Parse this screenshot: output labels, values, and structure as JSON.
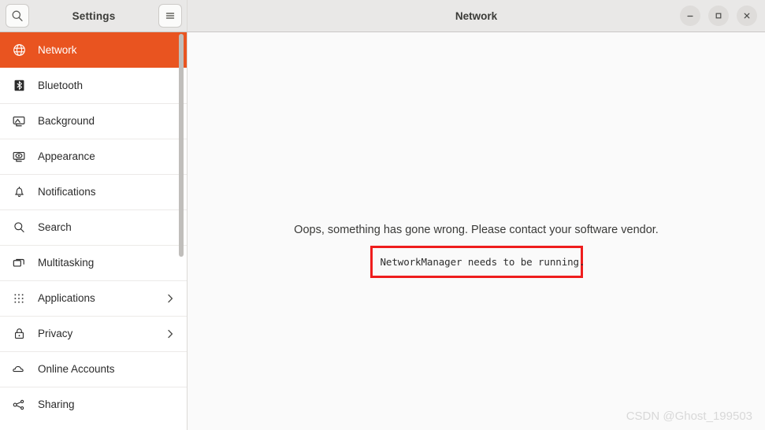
{
  "window": {
    "app_title": "Settings",
    "page_title": "Network",
    "controls": {
      "minimize_label": "Minimize",
      "maximize_label": "Maximize",
      "close_label": "Close"
    }
  },
  "header": {
    "search_icon": "search-icon",
    "menu_icon": "hamburger-menu-icon"
  },
  "sidebar": {
    "items": [
      {
        "label": "Network",
        "icon": "globe-icon",
        "selected": true,
        "chevron": false
      },
      {
        "label": "Bluetooth",
        "icon": "bluetooth-icon",
        "selected": false,
        "chevron": false
      },
      {
        "label": "Background",
        "icon": "monitor-icon",
        "selected": false,
        "chevron": false
      },
      {
        "label": "Appearance",
        "icon": "appearance-icon",
        "selected": false,
        "chevron": false
      },
      {
        "label": "Notifications",
        "icon": "bell-icon",
        "selected": false,
        "chevron": false
      },
      {
        "label": "Search",
        "icon": "search-icon",
        "selected": false,
        "chevron": false
      },
      {
        "label": "Multitasking",
        "icon": "windows-icon",
        "selected": false,
        "chevron": false
      },
      {
        "label": "Applications",
        "icon": "grid-dots-icon",
        "selected": false,
        "chevron": true
      },
      {
        "label": "Privacy",
        "icon": "lock-icon",
        "selected": false,
        "chevron": true
      },
      {
        "label": "Online Accounts",
        "icon": "cloud-icon",
        "selected": false,
        "chevron": false
      },
      {
        "label": "Sharing",
        "icon": "share-nodes-icon",
        "selected": false,
        "chevron": false
      }
    ]
  },
  "content": {
    "message": "Oops, something has gone wrong. Please contact your software vendor.",
    "error_detail": "NetworkManager needs to be running.",
    "error_box_border_color": "#ef1d1d"
  },
  "watermark": {
    "text": "CSDN @Ghost_199503"
  },
  "colors": {
    "accent": "#e95420",
    "headerbar": "#e9e8e7",
    "sidebar_bg": "#ffffff",
    "content_bg": "#fafafa",
    "error_red": "#ef1d1d"
  }
}
